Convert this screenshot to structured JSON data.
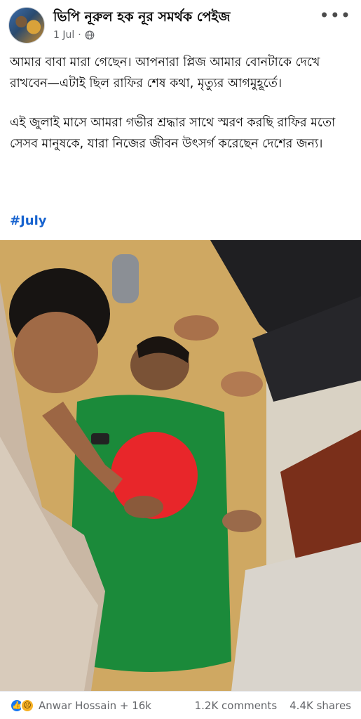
{
  "post": {
    "page_name": "ভিপি নূরুল হক নূর সমর্থক পেইজ",
    "date": "1 Jul",
    "privacy_icon": "globe-icon",
    "more_icon": "more-options-icon",
    "paragraph_1": "আমার বাবা মারা গেছেন। আপনারা প্লিজ আমার বোনটাকে দেখে রাখবেন—এটাই ছিল রাফির শেষ কথা, মৃত্যুর আগমুহূর্তে।",
    "paragraph_2": "এই জুলাই মাসে আমরা গভীর শ্রদ্ধার সাথে স্মরণ করছি রাফির মতো সেসব মানুষকে, যারা নিজের জীবন উৎসর্গ করেছেন দেশের জন্য।",
    "hashtag": "#July",
    "flag_colors": {
      "green": "#1b8a3a",
      "red": "#e8262a"
    }
  },
  "footer": {
    "reaction_icons": [
      "like-icon",
      "sad-icon"
    ],
    "reactors": "Anwar Hossain + 16k",
    "comments": "1.2K comments",
    "shares": "4.4K shares"
  }
}
